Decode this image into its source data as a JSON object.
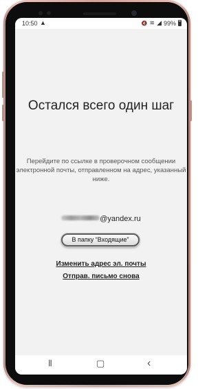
{
  "status_bar": {
    "time": "10:50",
    "warning_glyph": "▲",
    "mute_glyph": "🔇",
    "wifi_glyph": "≋",
    "signal_glyph": "◢",
    "battery_percent": "99%"
  },
  "content": {
    "title": "Остался всего один шаг",
    "description": "Перейдите по ссылке в проверочном сообщении электронной почты, отправленном на адрес, указанный ниже.",
    "email_domain": "@yandex.ru",
    "inbox_button": "В папку “Входящие”",
    "change_email_link": "Изменить адрес эл. почты",
    "resend_link": "Отправ. письмо снова"
  },
  "nav_bar": {
    "recents_glyph": "|||",
    "home_glyph": "▢",
    "back_glyph": "‹"
  },
  "colors": {
    "phone_frame": "#cfa49a",
    "bezel": "#0d0d0d",
    "screen_bg": "#f2f2f2",
    "text": "#222222"
  }
}
